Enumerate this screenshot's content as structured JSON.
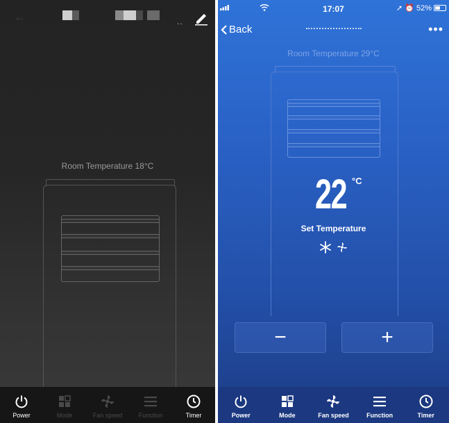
{
  "left_screen": {
    "room_temperature": "Room Temperature  18°C",
    "bottom_bar": [
      {
        "label": "Power",
        "active": true
      },
      {
        "label": "Mode",
        "active": false
      },
      {
        "label": "Fan speed",
        "active": false
      },
      {
        "label": "Function",
        "active": false
      },
      {
        "label": "Timer",
        "active": true
      }
    ]
  },
  "right_screen": {
    "status_bar": {
      "time": "17:07",
      "battery": "52%",
      "battery_fraction": 0.52
    },
    "nav": {
      "back_label": "Back",
      "more": "•••"
    },
    "room_temperature": "Room Temperature  29°C",
    "set_temperature": {
      "value": "22",
      "unit": "°C",
      "label": "Set Temperature"
    },
    "controls": {
      "minus": "−",
      "plus": "+"
    },
    "bottom_bar": [
      {
        "label": "Power"
      },
      {
        "label": "Mode"
      },
      {
        "label": "Fan speed"
      },
      {
        "label": "Function"
      },
      {
        "label": "Timer"
      }
    ]
  },
  "icons": [
    "power-icon",
    "mode-icon",
    "fan-speed-icon",
    "function-icon",
    "timer-icon",
    "snowflake-icon",
    "fan-icon",
    "edit-icon",
    "back-icon"
  ]
}
